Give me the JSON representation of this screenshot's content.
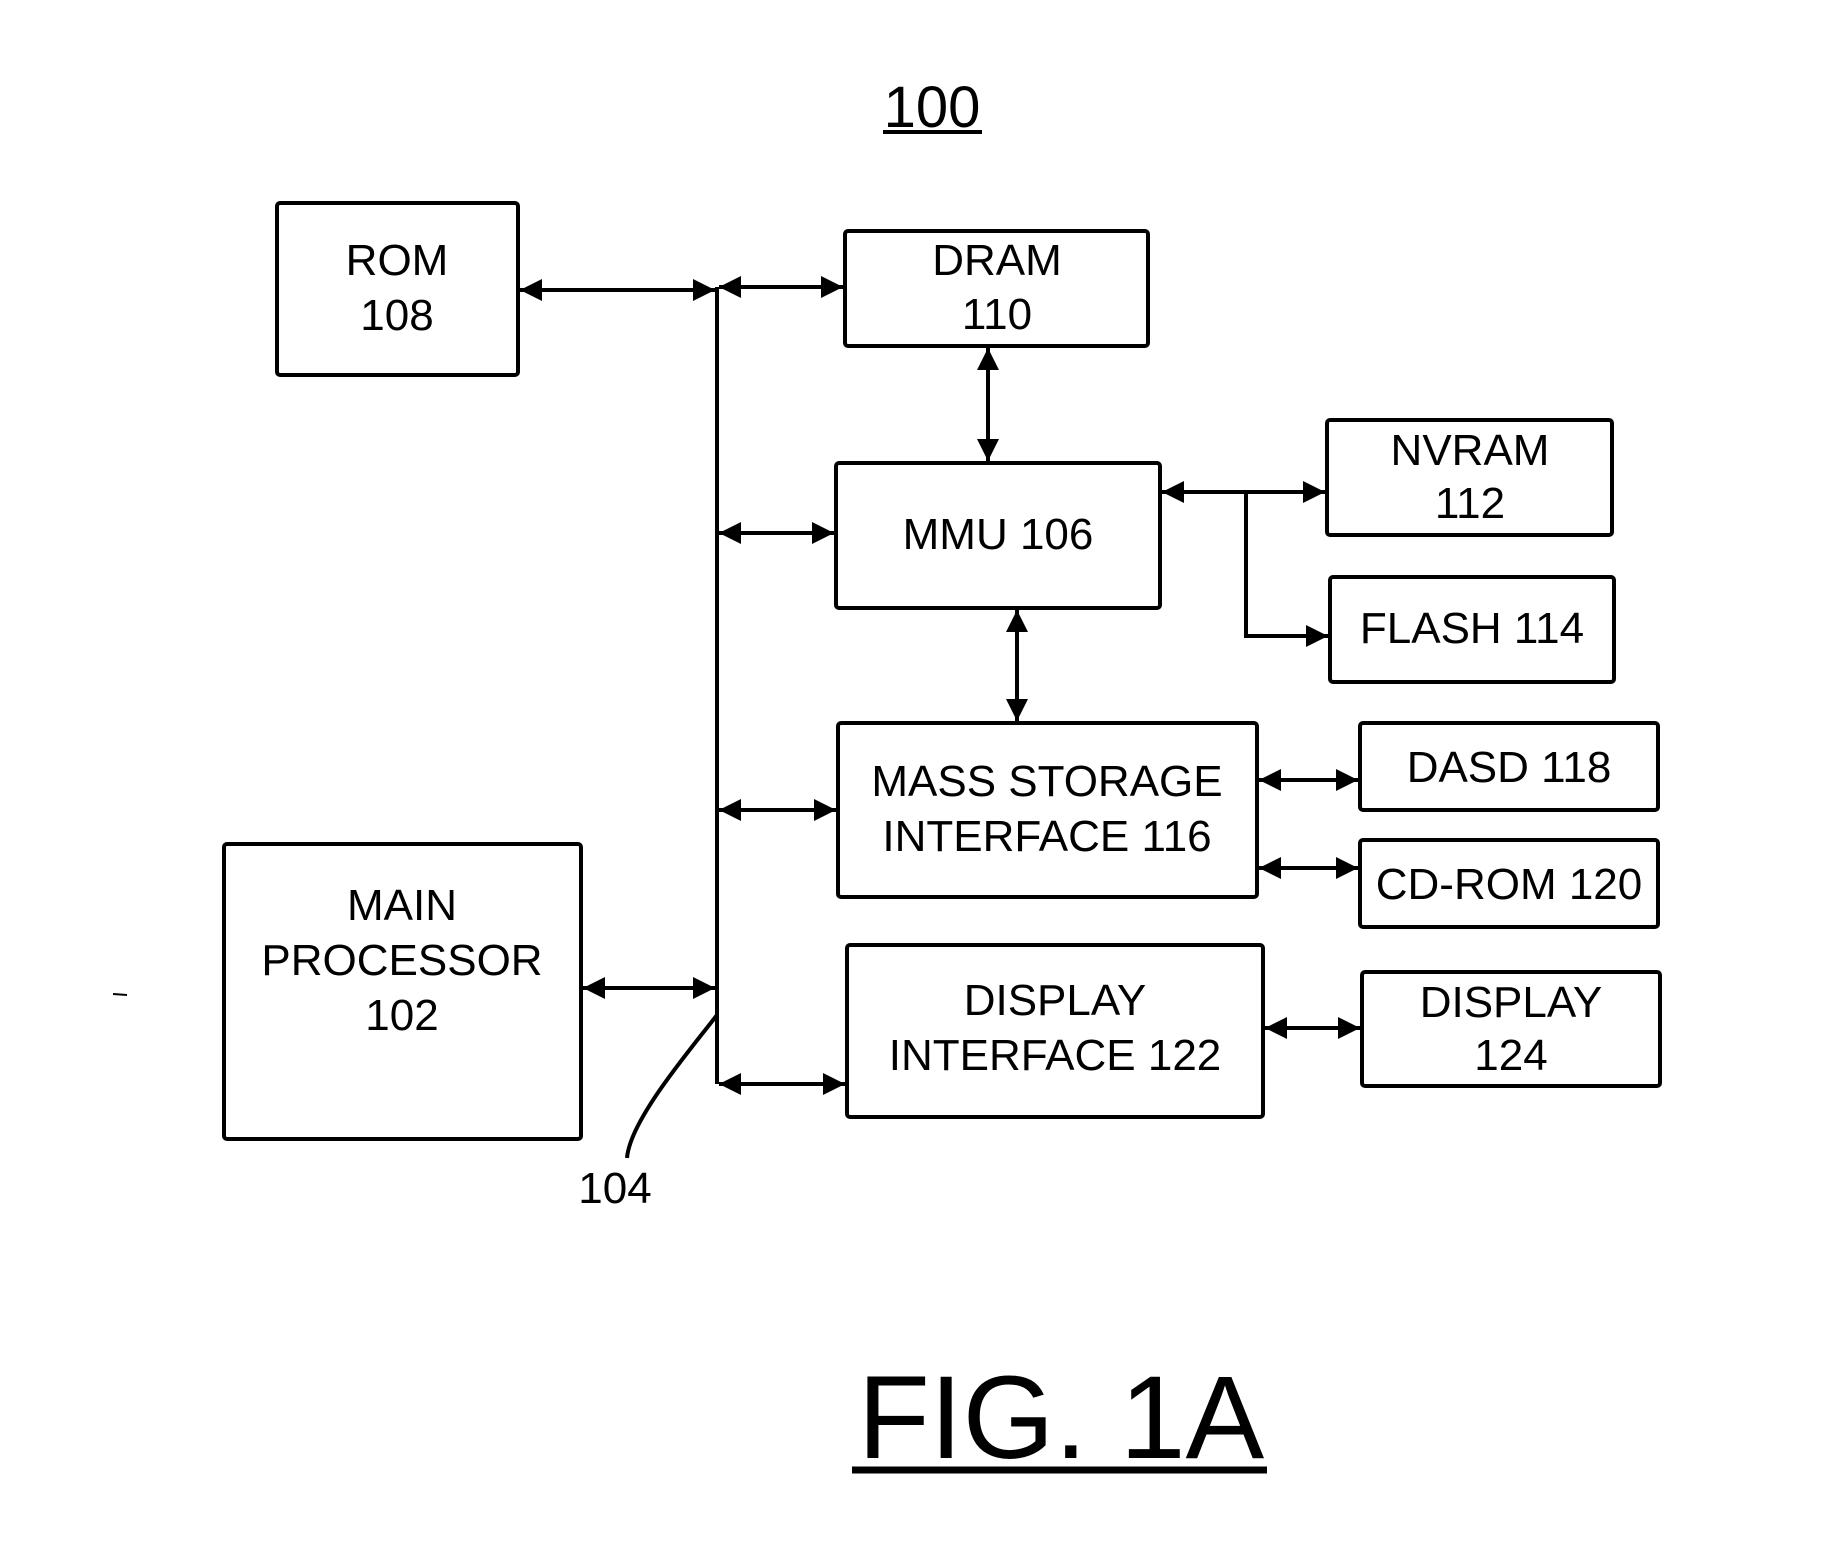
{
  "figure": {
    "reference_number": "100",
    "caption": "FIG. 1A",
    "bus_label": "104"
  },
  "blocks": {
    "rom": {
      "lines": [
        "ROM",
        "108"
      ]
    },
    "dram": {
      "lines": [
        "DRAM",
        "110"
      ]
    },
    "mmu": {
      "lines": [
        "MMU 106"
      ]
    },
    "nvram": {
      "lines": [
        "NVRAM",
        "112"
      ]
    },
    "flash": {
      "lines": [
        "FLASH 114"
      ]
    },
    "mass_storage_interface": {
      "lines": [
        "MASS STORAGE",
        "INTERFACE 116"
      ]
    },
    "dasd": {
      "lines": [
        "DASD 118"
      ]
    },
    "cdrom": {
      "lines": [
        "CD-ROM 120"
      ]
    },
    "main_processor": {
      "lines": [
        "MAIN",
        "PROCESSOR",
        "102"
      ]
    },
    "display_interface": {
      "lines": [
        "DISPLAY",
        "INTERFACE 122"
      ]
    },
    "display": {
      "lines": [
        "DISPLAY",
        "124"
      ]
    }
  },
  "connections": [
    {
      "from": "rom",
      "to": "bus",
      "type": "bidirectional"
    },
    {
      "from": "bus",
      "to": "dram",
      "type": "bidirectional"
    },
    {
      "from": "dram",
      "to": "mmu",
      "type": "bidirectional"
    },
    {
      "from": "bus",
      "to": "mmu",
      "type": "bidirectional"
    },
    {
      "from": "mmu",
      "to": "nvram",
      "type": "bidirectional"
    },
    {
      "from": "mmu",
      "to": "flash",
      "type": "unidirectional"
    },
    {
      "from": "mmu",
      "to": "mass_storage_interface",
      "type": "bidirectional"
    },
    {
      "from": "bus",
      "to": "mass_storage_interface",
      "type": "bidirectional"
    },
    {
      "from": "mass_storage_interface",
      "to": "dasd",
      "type": "bidirectional"
    },
    {
      "from": "mass_storage_interface",
      "to": "cdrom",
      "type": "bidirectional"
    },
    {
      "from": "main_processor",
      "to": "bus",
      "type": "bidirectional"
    },
    {
      "from": "bus",
      "to": "display_interface",
      "type": "bidirectional"
    },
    {
      "from": "display_interface",
      "to": "display",
      "type": "bidirectional"
    }
  ]
}
